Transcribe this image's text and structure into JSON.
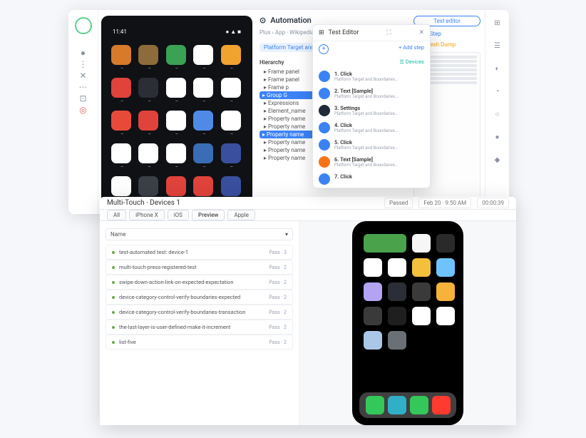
{
  "win1": {
    "sidebar_icons": [
      "●",
      "⋮",
      "✕",
      "⋯",
      "⊡",
      "◎"
    ],
    "far_icons": [
      "⊞",
      "☰",
      "◐",
      "◔",
      "○",
      "●",
      "◆"
    ],
    "phone": {
      "time": "11:41",
      "status_right": "● ▲ ■",
      "apps": [
        {
          "bg": "#d77a2a"
        },
        {
          "bg": "#8e6b3a"
        },
        {
          "bg": "#3aa155"
        },
        {
          "bg": "#ffffff"
        },
        {
          "bg": "#f0a32e"
        },
        {
          "bg": "#e0423c"
        },
        {
          "bg": "#2b2e36"
        },
        {
          "bg": "#ffffff"
        },
        {
          "bg": "#ffffff"
        },
        {
          "bg": "#ffffff"
        },
        {
          "bg": "#e84a3a"
        },
        {
          "bg": "#e0423c"
        },
        {
          "bg": "#ffffff"
        },
        {
          "bg": "#4f8be6"
        },
        {
          "bg": "#ffffff"
        },
        {
          "bg": "#ffffff"
        },
        {
          "bg": "#ffffff"
        },
        {
          "bg": "#ffffff"
        },
        {
          "bg": "#3a6db5"
        },
        {
          "bg": "#3a4f9e"
        },
        {
          "bg": "#ffffff"
        },
        {
          "bg": "#3a3f48"
        },
        {
          "bg": "#e0423c"
        },
        {
          "bg": "#e0423c"
        },
        {
          "bg": "#3a4f9e"
        }
      ]
    },
    "automation": {
      "title": "Automation",
      "breadcrumb": "Plus › App · Wikipedia",
      "chip": "Platform Target and Boundaries. Wikipe...",
      "hierarchy_title": "Hierarchy",
      "tree": [
        {
          "t": "Frame panel",
          "sel": false
        },
        {
          "t": "Frame panel",
          "sel": false
        },
        {
          "t": "Frame p",
          "sel": false
        },
        {
          "t": "Group G",
          "sel": true
        },
        {
          "t": "Expressions",
          "sel": false
        },
        {
          "t": "Element_name",
          "sel": false
        },
        {
          "t": "Property name",
          "sel": false
        },
        {
          "t": "Property name",
          "sel": false
        },
        {
          "t": "Property name",
          "sel": true
        },
        {
          "t": "Property name",
          "sel": false
        },
        {
          "t": "Property name",
          "sel": false
        },
        {
          "t": "Property name",
          "sel": false
        }
      ]
    },
    "popup": {
      "title": "Test Editor",
      "add_step": "+ Add step",
      "devices": "☰ Devices",
      "steps": [
        {
          "n": "1. Click",
          "sub": "Platform Target and Boundaries...",
          "c": "#3b82f6"
        },
        {
          "n": "2. Text [Sample]",
          "sub": "Platform Target and Boundaries...",
          "c": "#3b82f6"
        },
        {
          "n": "3. Settings",
          "sub": "Platform Target and Boundaries...",
          "c": "#1f2937"
        },
        {
          "n": "4. Click",
          "sub": "Platform Target and Boundaries...",
          "c": "#3b82f6"
        },
        {
          "n": "5. Click",
          "sub": "Platform Target and Boundaries...",
          "c": "#3b82f6"
        },
        {
          "n": "6. Text [Sample]",
          "sub": "Platform Target and Boundaries...",
          "c": "#f97316"
        },
        {
          "n": "7. Click",
          "sub": "",
          "c": "#3b82f6"
        }
      ]
    },
    "right": {
      "test_editor_btn": "Test editor",
      "add_step": "+ Add Step",
      "refresh": "↻ Refresh Dump"
    }
  },
  "win2": {
    "title": "Multi-Touch · Devices 1",
    "meta": {
      "status": "Passed",
      "time": "Feb 20 · 9:50 AM",
      "dur": "00:00:39"
    },
    "tabs": [
      "All",
      "iPhone X",
      "iOS",
      "Preview",
      "Apple"
    ],
    "filter": "Name",
    "logs": [
      {
        "t": "test-automated test: device-1",
        "r": "Pass · 3"
      },
      {
        "t": "multi-touch-press-registered-test",
        "r": "Pass · 2"
      },
      {
        "t": "swipe-down-action-link-on-expected-expectation",
        "r": "Pass · 2"
      },
      {
        "t": "device-category-control-verify-boundaries-expected",
        "r": "Pass · 2"
      },
      {
        "t": "device-category-control-verify-boundaries-transaction",
        "r": "Pass · 2"
      },
      {
        "t": "the-last-layer-is-user-defined-make-it-increment",
        "r": "Pass · 2"
      },
      {
        "t": "list-five",
        "r": "Pass · 2"
      }
    ],
    "iphone": {
      "apps": [
        {
          "bg": "#4aa24a",
          "widget": true
        },
        {
          "bg": "#f6f6f6"
        },
        {
          "bg": "#2a2a2a"
        },
        {
          "bg": "#ffffff"
        },
        {
          "bg": "#ffffff"
        },
        {
          "bg": "#f2c03a"
        },
        {
          "bg": "#6ec3ff"
        },
        {
          "bg": "#b4a3f2"
        },
        {
          "bg": "#2b2e36"
        },
        {
          "bg": "#3a3a3a"
        },
        {
          "bg": "#f7b23a"
        },
        {
          "bg": "#3a3a3a"
        },
        {
          "bg": "#1f1f1f"
        },
        {
          "bg": "#ffffff"
        },
        {
          "bg": "#ffffff"
        },
        {
          "bg": "#a9c8e8"
        },
        {
          "bg": "#6b6f76"
        }
      ],
      "dock": [
        {
          "bg": "#34c759"
        },
        {
          "bg": "#30b0c7"
        },
        {
          "bg": "#34c759"
        },
        {
          "bg": "#ff3b30"
        }
      ]
    }
  }
}
